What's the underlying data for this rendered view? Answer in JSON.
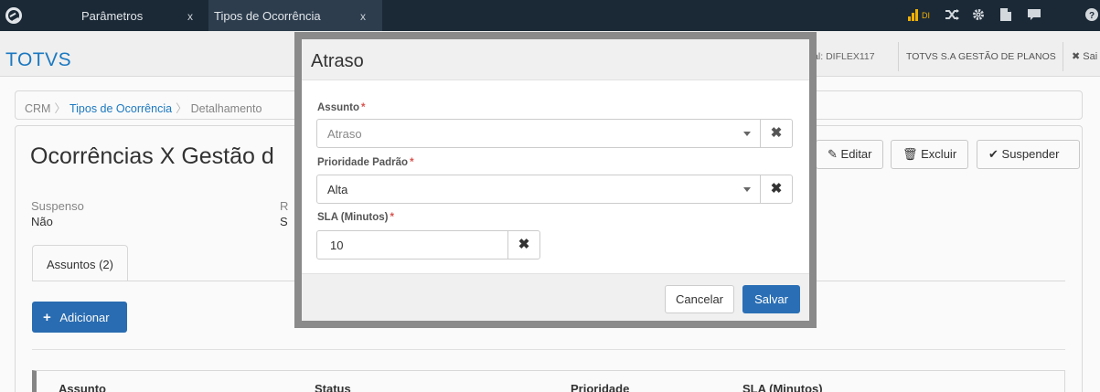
{
  "topbar": {
    "tabs": [
      {
        "label": "Parâmetros",
        "close": "x"
      },
      {
        "label": "Tipos de Ocorrência",
        "close": "x"
      }
    ],
    "icons": [
      "signal-bars-icon",
      "shuffle-icon",
      "gear-icon",
      "document-icon",
      "chat-icon",
      "help-icon"
    ],
    "signal_label": "DI"
  },
  "header": {
    "brand": "TOTVS",
    "local": "ocal: DIFLEX117",
    "company": "TOTVS S.A GESTÃO DE PLANOS",
    "exit": "Sai"
  },
  "breadcrumb": {
    "items": [
      "CRM",
      "Tipos de Ocorrência",
      "Detalhamento"
    ]
  },
  "main": {
    "title": "Ocorrências X Gestão d",
    "buttons": {
      "edit": "Editar",
      "delete": "Excluir",
      "suspend": "Suspender"
    },
    "fields": [
      {
        "label": "Suspenso",
        "value": "Não"
      },
      {
        "label": "R",
        "value": "S"
      }
    ],
    "tab": "Assuntos (2)",
    "add_button": "Adicionar",
    "table_headers": [
      "Assunto",
      "Status",
      "Prioridade",
      "SLA (Minutos)"
    ]
  },
  "modal": {
    "title": "Atraso",
    "fields": {
      "assunto": {
        "label": "Assunto",
        "value": "Atraso"
      },
      "prioridade": {
        "label": "Prioridade Padrão",
        "value": "Alta"
      },
      "sla": {
        "label": "SLA (Minutos)",
        "value": "10"
      }
    },
    "required_mark": "*",
    "clear_glyph": "✖",
    "cancel": "Cancelar",
    "save": "Salvar"
  },
  "colors": {
    "primary": "#2a6fb5",
    "topbar": "#1c2a38",
    "brand": "#1c7bc4",
    "required": "#d9534f"
  }
}
